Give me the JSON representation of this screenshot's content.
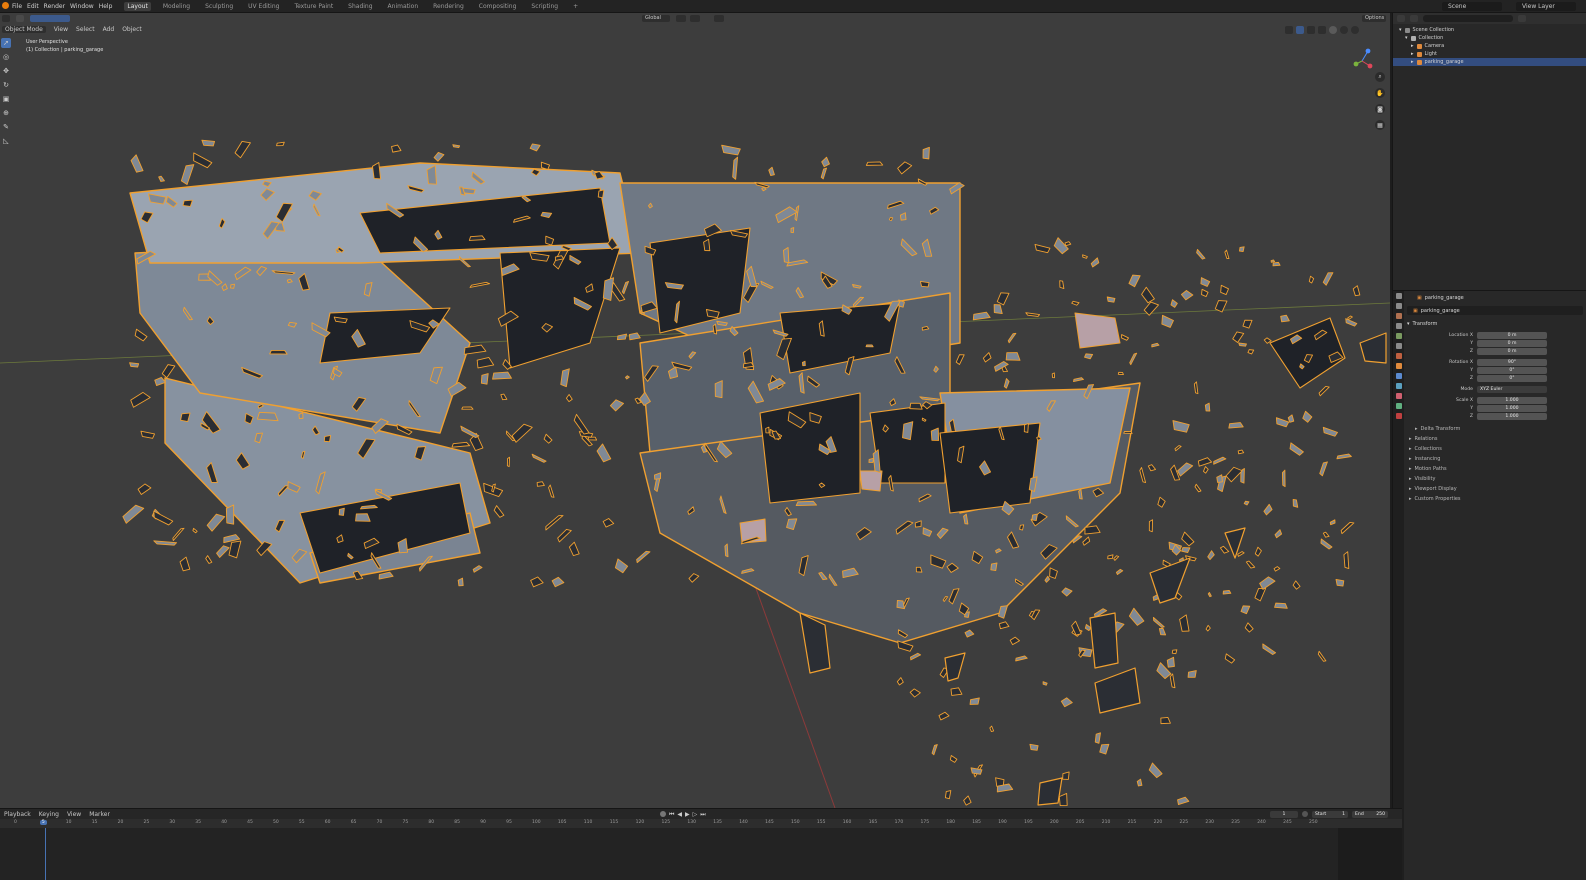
{
  "menu": [
    "File",
    "Edit",
    "Render",
    "Window",
    "Help"
  ],
  "workspaces": [
    "Layout",
    "Modeling",
    "Sculpting",
    "UV Editing",
    "Texture Paint",
    "Shading",
    "Animation",
    "Rendering",
    "Compositing",
    "Scripting",
    "+"
  ],
  "active_workspace": "Layout",
  "scene_label": "Scene",
  "view_layer_label": "View Layer",
  "viewport": {
    "mode": "Object Mode",
    "menus": [
      "View",
      "Select",
      "Add",
      "Object"
    ],
    "transform_orientation": "Global",
    "options_label": "Options",
    "info_line1": "User Perspective",
    "info_line2": "(1) Collection | parking_garage"
  },
  "outliner": {
    "rows": [
      {
        "label": "Scene Collection",
        "indent": 0,
        "color": "#8a8a8a",
        "selected": false
      },
      {
        "label": "Collection",
        "indent": 1,
        "color": "#b0b0b0",
        "selected": false
      },
      {
        "label": "Camera",
        "indent": 2,
        "color": "#e08a3c",
        "selected": false
      },
      {
        "label": "Light",
        "indent": 2,
        "color": "#e08a3c",
        "selected": false
      },
      {
        "label": "parking_garage",
        "indent": 2,
        "color": "#e08a3c",
        "selected": true
      }
    ]
  },
  "properties": {
    "object_name": "parking_garage",
    "data_name": "parking_garage",
    "transform_title": "Transform",
    "location": {
      "label": "Location X",
      "x": "0 m",
      "y": "0 m",
      "z": "0 m"
    },
    "rotation": {
      "label": "Rotation X",
      "x": "90°",
      "y": "0°",
      "z": "0°"
    },
    "mode_label": "Mode",
    "mode_value": "XYZ Euler",
    "scale": {
      "label": "Scale X",
      "x": "1.000",
      "y": "1.000",
      "z": "1.000"
    },
    "delta_transform": "Delta Transform",
    "sections": [
      "Relations",
      "Collections",
      "Instancing",
      "Motion Paths",
      "Visibility",
      "Viewport Display",
      "Custom Properties"
    ]
  },
  "timeline": {
    "menus": [
      "Playback",
      "Keying",
      "View",
      "Marker"
    ],
    "current_frame": "1",
    "start_label": "Start",
    "start_value": "1",
    "end_label": "End",
    "end_value": "250",
    "ticks": [
      "0",
      "5",
      "10",
      "15",
      "20",
      "25",
      "30",
      "35",
      "40",
      "45",
      "50",
      "55",
      "60",
      "65",
      "70",
      "75",
      "80",
      "85",
      "90",
      "95",
      "100",
      "105",
      "110",
      "115",
      "120",
      "125",
      "130",
      "135",
      "140",
      "145",
      "150",
      "155",
      "160",
      "165",
      "170",
      "175",
      "180",
      "185",
      "190",
      "195",
      "200",
      "205",
      "210",
      "215",
      "220",
      "225",
      "230",
      "235",
      "240",
      "245",
      "250"
    ]
  },
  "colors": {
    "accent": "#4772b3",
    "selection_outline": "#f0a030",
    "mesh_light": "#8a95a3",
    "mesh_dark": "#1f2228",
    "viewport_bg": "#3d3d3d"
  }
}
